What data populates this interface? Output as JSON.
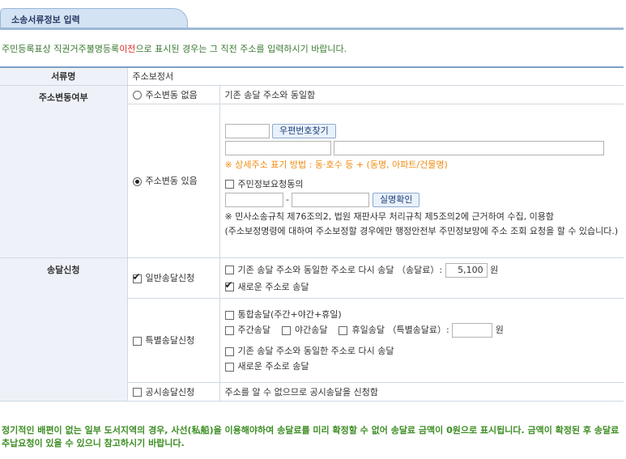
{
  "tab_title": "소송서류정보 입력",
  "notice": {
    "before": "주민등록표상 직권거주불명등록",
    "highlight": "이전",
    "after": "으로 표시된 경우는 그 직전 주소를 입력하시기 바랍니다."
  },
  "doc_name": {
    "label": "서류명",
    "value": "주소보정서"
  },
  "address_change": {
    "label": "주소변동여부",
    "no_change_label": "주소변동 없음",
    "no_change_desc": "기존 송달 주소와 동일함",
    "change_label": "주소변동 있음",
    "zip_button": "우편번호찾기",
    "address_hint": "※ 상세주소 표기 방법 : 동·호수 등 + (동명, 아파트/건물명)",
    "consent_label": "주민정보요청동의",
    "id_dash": "-",
    "verify_button": "실명확인",
    "legal_note1": "※ 민사소송규칙 제76조의2, 법원 재판사무 처리규칙 제5조의2에 근거하여 수집, 이용함",
    "legal_note2": "(주소보정명령에 대하여 주소보정할 경우에만 행정안전부 주민정보망에 주소 조회 요청을 할 수 있습니다.)"
  },
  "delivery": {
    "label": "송달신청",
    "general_label": "일반송달신청",
    "general_same": "기존 송달 주소와 동일한 주소로 다시 송달 （송달료）:",
    "fee_value": "5,100",
    "won": "원",
    "general_new": "새로운 주소로 송달",
    "special_label": "특별송달신청",
    "integrated": "통합송달(주간+야간+휴일)",
    "daytime": "주간송달",
    "night": "야간송달",
    "holiday": "휴일송달 （특별송달료）:",
    "special_same": "기존 송달 주소와 동일한 주소로 다시 송달",
    "special_new": "새로운 주소로 송달",
    "public_label": "공시송달신청",
    "public_desc": "주소를 알 수 없으므로 공시송달을 신청함"
  },
  "footer": "정기적인 배편이 없는 일부 도서지역의 경우, 사선(私船)을 이용해야하여 송달료를 미리 확정할 수 없어 송달료 금액이 0원으로 표시됩니다. 금액이 확정된 후 송달료 추납요청이 있을 수 있으니 참고하시기 바랍니다."
}
